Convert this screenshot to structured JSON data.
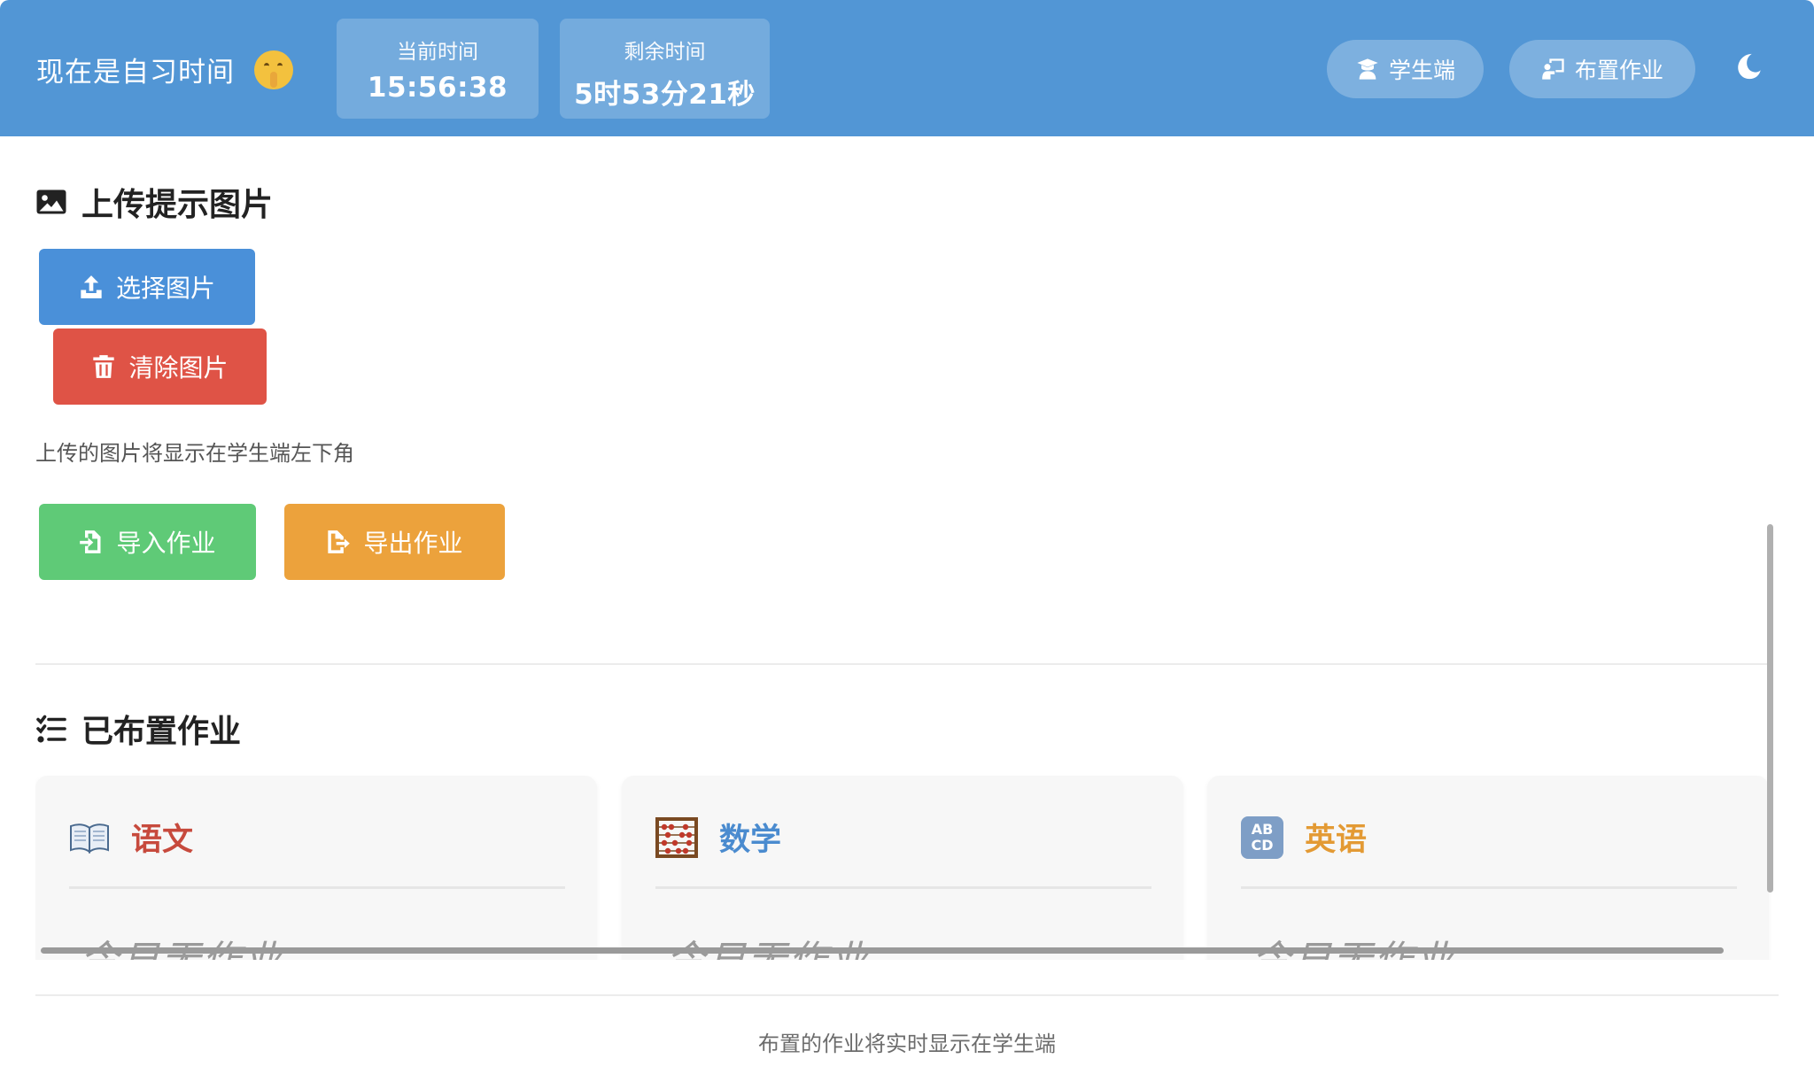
{
  "header": {
    "app_title": "现在是自习时间",
    "title_icon": "shushing-face-icon",
    "current_time_label": "当前时间",
    "current_time_value": "15:56:38",
    "remaining_label": "剩余时间",
    "remaining_value": "5时53分21秒",
    "student_button": "学生端",
    "assign_button": "布置作业",
    "theme_icon": "moon-icon",
    "bg_color": "#5296d5"
  },
  "upload": {
    "title": "上传提示图片",
    "choose_button": "选择图片",
    "clear_button": "清除图片",
    "hint": "上传的图片将显示在学生端左下角"
  },
  "io": {
    "import_button": "导入作业",
    "export_button": "导出作业"
  },
  "assigned": {
    "title": "已布置作业",
    "cards": [
      {
        "subject": "语文",
        "icon": "open-book-icon",
        "body": "今日无作业",
        "color": "#c74a3d"
      },
      {
        "subject": "数学",
        "icon": "abacus-icon",
        "body": "今日无作业",
        "color": "#4a8bcf"
      },
      {
        "subject": "英语",
        "icon": "abcd-icon",
        "body": "今日无作业",
        "color": "#e39a34"
      }
    ]
  },
  "footer": {
    "note": "布置的作业将实时显示在学生端"
  },
  "colors": {
    "choose": "#4a90d9",
    "clear": "#df5346",
    "import": "#5fca77",
    "export": "#eca23c"
  }
}
